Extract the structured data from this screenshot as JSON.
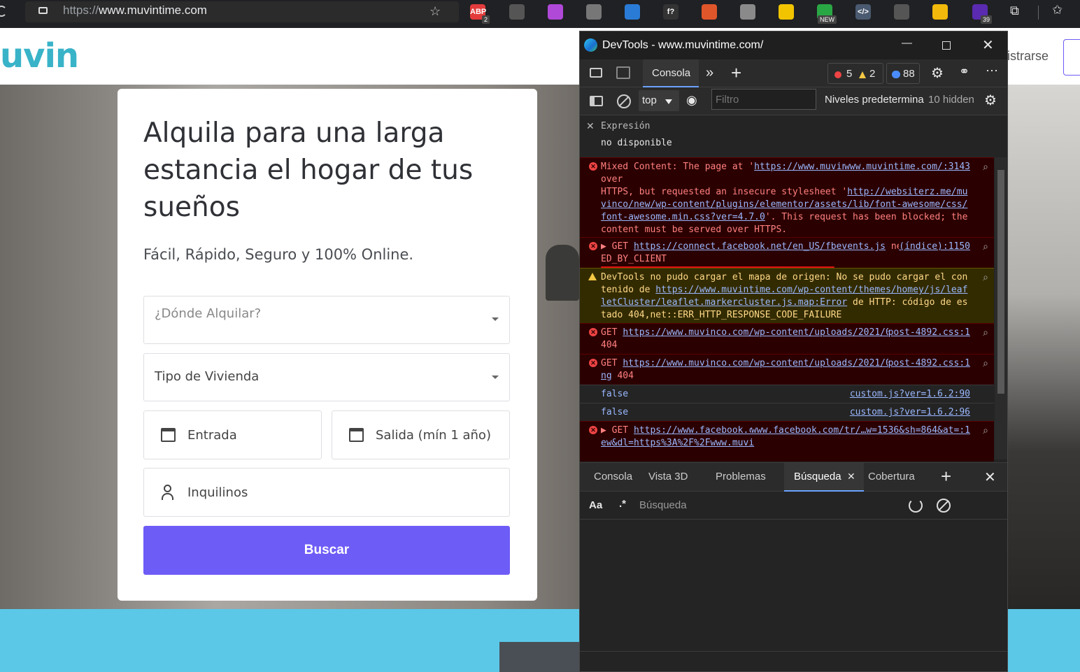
{
  "browser": {
    "url_scheme": "https://",
    "url_host": "www.muvintime.com",
    "extensions": [
      {
        "name": "adblock-icon",
        "label": "ABP",
        "badge": "2",
        "color": "#e33b3b"
      },
      {
        "name": "picture-in-picture-icon",
        "label": "",
        "badge": "",
        "color": "#555"
      },
      {
        "name": "color-picker-icon",
        "label": "",
        "badge": "",
        "color": "#b048d8"
      },
      {
        "name": "copy-extension-icon",
        "label": "",
        "badge": "",
        "color": "#777"
      },
      {
        "name": "bracket-extension-icon",
        "label": "",
        "badge": "",
        "color": "#2a7bd6"
      },
      {
        "name": "function-extension-icon",
        "label": "f?",
        "badge": "",
        "color": "#333"
      },
      {
        "name": "rocket-extension-icon",
        "label": "",
        "badge": "",
        "color": "#e0562b"
      },
      {
        "name": "printer-extension-icon",
        "label": "",
        "badge": "",
        "color": "#8a8a8a"
      },
      {
        "name": "star-extension-icon",
        "label": "",
        "badge": "",
        "color": "#f2c400"
      },
      {
        "name": "new-extension-icon",
        "label": "",
        "badge": "NEW",
        "color": "#2aa745"
      },
      {
        "name": "code-extension-icon",
        "label": "</>",
        "badge": "",
        "color": "#4a5a70"
      },
      {
        "name": "feather-extension-icon",
        "label": "",
        "badge": "",
        "color": "#555"
      },
      {
        "name": "binance-extension-icon",
        "label": "",
        "badge": "",
        "color": "#f0b90b"
      },
      {
        "name": "hat-extension-icon",
        "label": "",
        "badge": "39",
        "color": "#5a2bb0"
      }
    ]
  },
  "site": {
    "logo": "uvin",
    "register_label": "istrarse",
    "hero_title": "Alquila para una larga estancia el hogar de tus sueños",
    "hero_subtitle": "Fácil, Rápido, Seguro y 100% Online.",
    "location_placeholder": "¿Dónde Alquilar?",
    "housing_type": "Tipo de Vivienda",
    "checkin": "Entrada",
    "checkout": "Salida (mín 1 año)",
    "tenants": "Inquilinos",
    "search_button": "Buscar"
  },
  "devtools": {
    "title": "DevTools - www.muvintime.com/",
    "active_tab": "Consola",
    "errors_count": "5",
    "warnings_count": "2",
    "info_count": "88",
    "context": "top",
    "filter_placeholder": "Filtro",
    "levels": "Niveles predetermina",
    "hidden": "10 hidden",
    "expression_label": "Expresión",
    "expression_value": "no disponible",
    "messages": [
      {
        "level": "error",
        "text_before": "Mixed Content: The page at '",
        "link1": "https://",
        "text_mid": "",
        "link2": "www.muvintime.com/",
        "text_after": "' was loaded over\nHTTPS, but requested an insecure stylesheet '",
        "link3": "http://websiterz.me/muvinco/new/wp-content/plugins/elementor/assets/lib/font-awesome/css/font-awesome.min.css?ver=4.7.0",
        "text_end": "'. This request has been blocked; the content must be served over HTTPS.",
        "source": "www.muvintime.com/:3143"
      },
      {
        "level": "error",
        "text_before": "▶ GET ",
        "link1": "https://connect.facebook.net/en_US/fbevents.js",
        "text_after": " net::ERR_BLOCKED_BY_CLIENT",
        "source": "(índice):1150"
      },
      {
        "level": "warning",
        "text_before": "DevTools no pudo cargar el mapa de origen: No se pudo cargar el contenido de ",
        "link1": "https://www.muvintime.com/wp-content/themes/homey/js/leafletCluster/leaflet.markercluster.js.map:Error",
        "text_after": " de HTTP: código de estado 404,net::ERR_HTTP_RESPONSE_CODE_FAILURE",
        "source": ""
      },
      {
        "level": "error",
        "text_before": "GET ",
        "link1": "https://www.muvinco.com/wp-content/uploads/2021/01/Post-BG.png",
        "text_after": " 404",
        "source": "post-4892.css:1"
      },
      {
        "level": "error",
        "text_before": "GET ",
        "link1": "https://www.muvinco.com/wp-content/uploads/2021/01/CTA-Shapes.png",
        "text_after": " 404",
        "source": "post-4892.css:1"
      },
      {
        "level": "log",
        "text_before": "false",
        "source": "custom.js?ver=1.6.2:90"
      },
      {
        "level": "log",
        "text_before": "false",
        "source": "custom.js?ver=1.6.2:96"
      },
      {
        "level": "error",
        "text_before": "▶ GET ",
        "link1": "https://www.facebook.com/tr/?id=532160876956612&ev=fb_page_view&dl=https%3A%2F%2Fwww.muvi",
        "text_after": "",
        "source": "www.facebook.com/tr/…w=1536&sh=864&at=:1"
      }
    ],
    "drawer_tabs": [
      "Consola",
      "Vista 3D",
      "Problemas",
      "Búsqueda",
      "Cobertura"
    ],
    "drawer_active": "Búsqueda",
    "case_toggle": "Aa",
    "regex_toggle": ".*",
    "search_placeholder": "Búsqueda"
  }
}
